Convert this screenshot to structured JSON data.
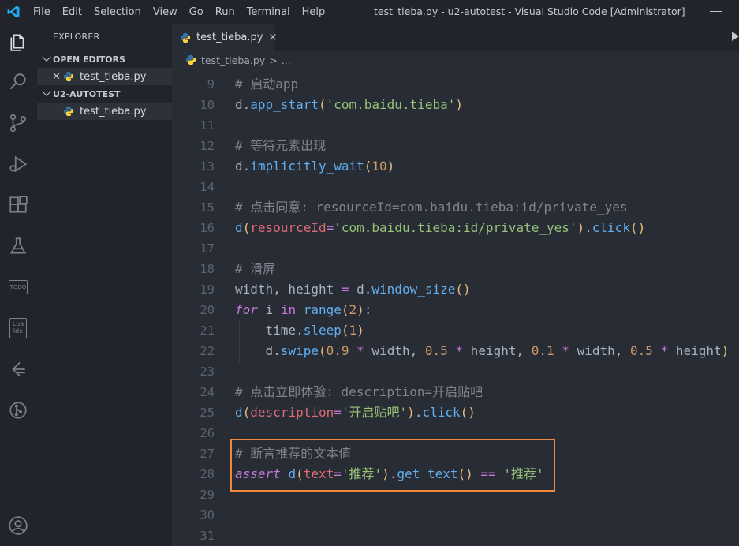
{
  "menu": [
    "File",
    "Edit",
    "Selection",
    "View",
    "Go",
    "Run",
    "Terminal",
    "Help"
  ],
  "window_title": "test_tieba.py - u2-autotest - Visual Studio Code [Administrator]",
  "sidebar": {
    "title": "EXPLORER",
    "open_editors_label": "OPEN EDITORS",
    "open_editor_file": "test_tieba.py",
    "project_label": "U2-AUTOTEST",
    "project_file": "test_tieba.py"
  },
  "activity_labels": {
    "todo": "TODO",
    "lua": "Lua Ide"
  },
  "tab": {
    "label": "test_tieba.py",
    "close": "×"
  },
  "breadcrumb": {
    "file": "test_tieba.py",
    "sep": ">",
    "more": "..."
  },
  "colors": {
    "accent_highlight": "#f0883e",
    "editor_bg": "#282c34",
    "sidebar_bg": "#21252b",
    "vscode_logo": "#23a9f2",
    "python_blue": "#3572A5",
    "python_yellow": "#ffd43b"
  },
  "icons": [
    "vscode-logo-icon",
    "files-icon",
    "search-icon",
    "source-control-icon",
    "run-debug-icon",
    "extensions-icon",
    "testing-flask-icon",
    "todo-icon",
    "lua-ide-icon",
    "git-graph-icon",
    "remote-git-icon",
    "account-icon",
    "python-file-icon",
    "run-play-icon"
  ],
  "code_lines": [
    {
      "n": "9",
      "tokens": [
        [
          "cm",
          "# 启动app"
        ]
      ]
    },
    {
      "n": "10",
      "tokens": [
        [
          "pl",
          "d."
        ],
        [
          "fn",
          "app_start"
        ],
        [
          "bk",
          "("
        ],
        [
          "st",
          "'com.baidu.tieba'"
        ],
        [
          "bk",
          ")"
        ]
      ]
    },
    {
      "n": "11",
      "tokens": []
    },
    {
      "n": "12",
      "tokens": [
        [
          "cm",
          "# 等待元素出现"
        ]
      ]
    },
    {
      "n": "13",
      "tokens": [
        [
          "pl",
          "d."
        ],
        [
          "fn",
          "implicitly_wait"
        ],
        [
          "bk",
          "("
        ],
        [
          "nm",
          "10"
        ],
        [
          "bk",
          ")"
        ]
      ]
    },
    {
      "n": "14",
      "tokens": []
    },
    {
      "n": "15",
      "tokens": [
        [
          "cm",
          "# 点击同意: resourceId=com.baidu.tieba:id/private_yes"
        ]
      ]
    },
    {
      "n": "16",
      "tokens": [
        [
          "fn",
          "d"
        ],
        [
          "bk",
          "("
        ],
        [
          "pr",
          "resourceId"
        ],
        [
          "op",
          "="
        ],
        [
          "st",
          "'com.baidu.tieba:id/private_yes'"
        ],
        [
          "bk",
          ")"
        ],
        [
          "pl",
          "."
        ],
        [
          "fn",
          "click"
        ],
        [
          "bk",
          "()"
        ]
      ]
    },
    {
      "n": "17",
      "tokens": []
    },
    {
      "n": "18",
      "tokens": [
        [
          "cm",
          "# 滑屏"
        ]
      ]
    },
    {
      "n": "19",
      "tokens": [
        [
          "pl",
          "width, height "
        ],
        [
          "op",
          "="
        ],
        [
          "pl",
          " d."
        ],
        [
          "fn",
          "window_size"
        ],
        [
          "bk",
          "()"
        ]
      ]
    },
    {
      "n": "20",
      "tokens": [
        [
          "kw",
          "for"
        ],
        [
          "pl",
          " i "
        ],
        [
          "kwn",
          "in"
        ],
        [
          "pl",
          " "
        ],
        [
          "fn",
          "range"
        ],
        [
          "bk",
          "("
        ],
        [
          "nm",
          "2"
        ],
        [
          "bk",
          ")"
        ],
        [
          "pl",
          ":"
        ]
      ]
    },
    {
      "n": "21",
      "tokens": [
        [
          "pl",
          "    time."
        ],
        [
          "fn",
          "sleep"
        ],
        [
          "bk",
          "("
        ],
        [
          "nm",
          "1"
        ],
        [
          "bk",
          ")"
        ]
      ]
    },
    {
      "n": "22",
      "tokens": [
        [
          "pl",
          "    d."
        ],
        [
          "fn",
          "swipe"
        ],
        [
          "bk",
          "("
        ],
        [
          "nm",
          "0.9"
        ],
        [
          "pl",
          " "
        ],
        [
          "op",
          "*"
        ],
        [
          "pl",
          " width, "
        ],
        [
          "nm",
          "0.5"
        ],
        [
          "pl",
          " "
        ],
        [
          "op",
          "*"
        ],
        [
          "pl",
          " height, "
        ],
        [
          "nm",
          "0.1"
        ],
        [
          "pl",
          " "
        ],
        [
          "op",
          "*"
        ],
        [
          "pl",
          " width, "
        ],
        [
          "nm",
          "0.5"
        ],
        [
          "pl",
          " "
        ],
        [
          "op",
          "*"
        ],
        [
          "pl",
          " height"
        ],
        [
          "bk",
          ")"
        ]
      ]
    },
    {
      "n": "23",
      "tokens": []
    },
    {
      "n": "24",
      "tokens": [
        [
          "cm",
          "# 点击立即体验: description=开启贴吧"
        ]
      ]
    },
    {
      "n": "25",
      "tokens": [
        [
          "fn",
          "d"
        ],
        [
          "bk",
          "("
        ],
        [
          "pr",
          "description"
        ],
        [
          "op",
          "="
        ],
        [
          "st",
          "'开启贴吧'"
        ],
        [
          "bk",
          ")"
        ],
        [
          "pl",
          "."
        ],
        [
          "fn",
          "click"
        ],
        [
          "bk",
          "()"
        ]
      ]
    },
    {
      "n": "26",
      "tokens": []
    },
    {
      "n": "27",
      "tokens": [
        [
          "cm",
          "# 断言推荐的文本值"
        ]
      ]
    },
    {
      "n": "28",
      "tokens": [
        [
          "kw",
          "assert"
        ],
        [
          "pl",
          " "
        ],
        [
          "fn",
          "d"
        ],
        [
          "bk",
          "("
        ],
        [
          "pr",
          "text"
        ],
        [
          "op",
          "="
        ],
        [
          "st",
          "'推荐'"
        ],
        [
          "bk",
          ")"
        ],
        [
          "pl",
          "."
        ],
        [
          "fn",
          "get_text"
        ],
        [
          "bk",
          "()"
        ],
        [
          "pl",
          " "
        ],
        [
          "op",
          "=="
        ],
        [
          "pl",
          " "
        ],
        [
          "st",
          "'推荐'"
        ]
      ]
    },
    {
      "n": "29",
      "tokens": []
    },
    {
      "n": "30",
      "tokens": []
    },
    {
      "n": "31",
      "tokens": []
    }
  ]
}
